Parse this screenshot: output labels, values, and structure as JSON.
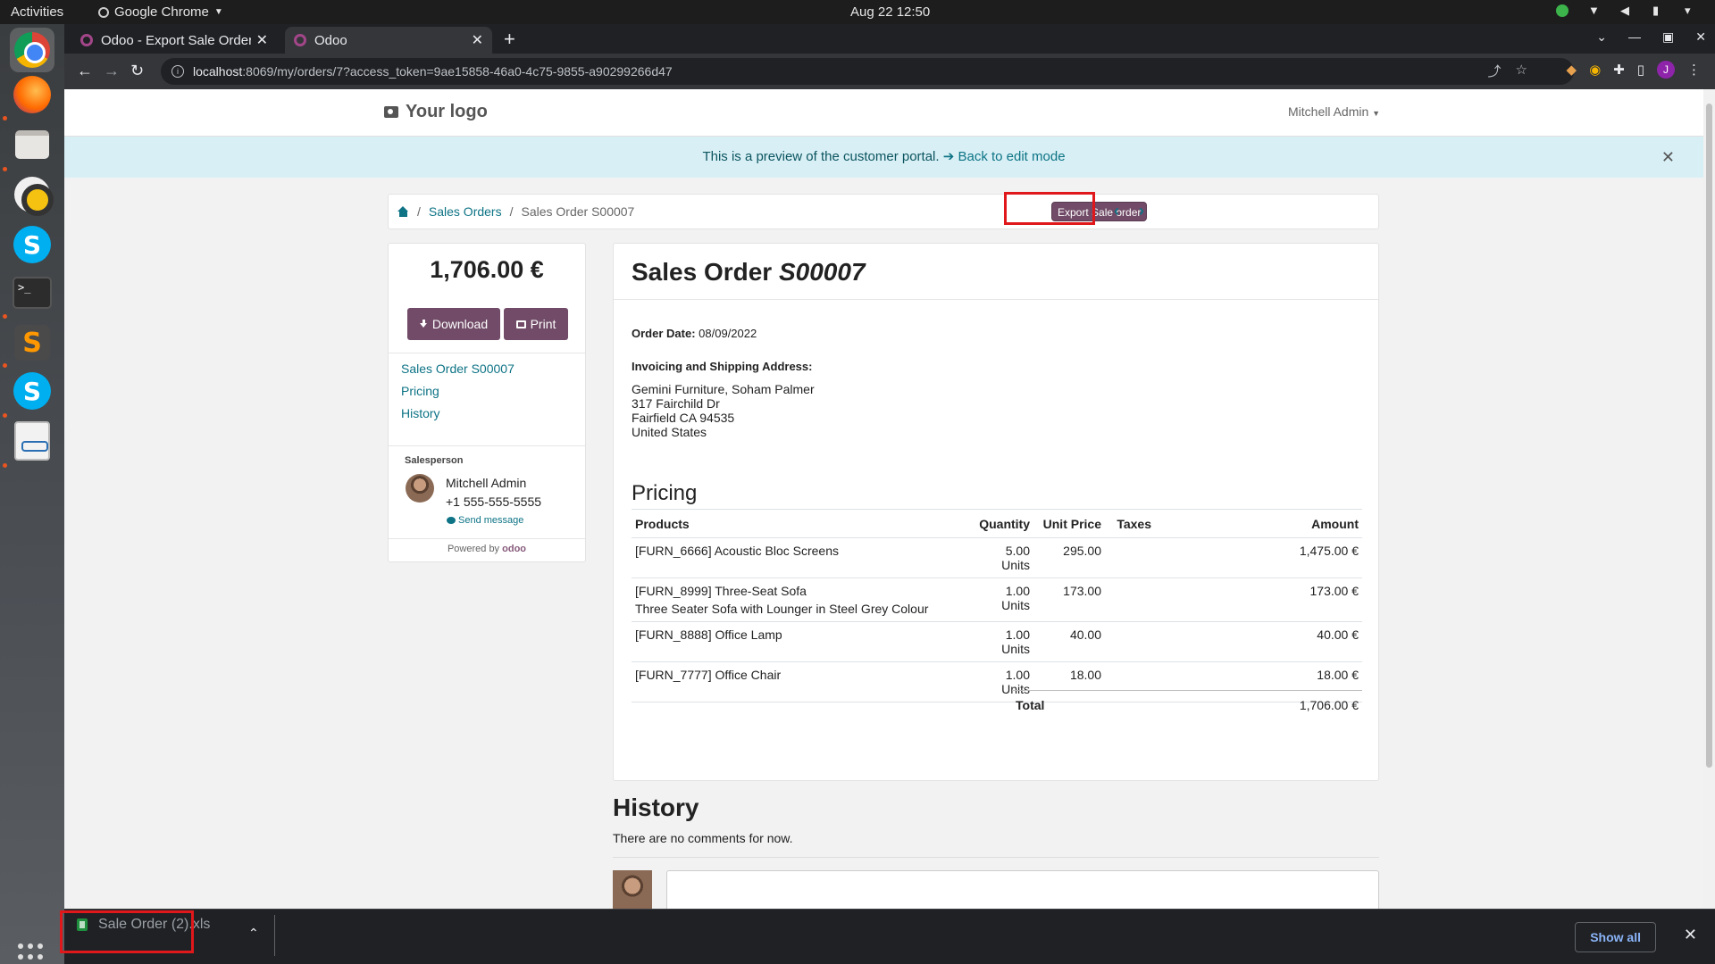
{
  "os": {
    "activities": "Activities",
    "app_name": "Google Chrome",
    "clock": "Aug 22  12:50"
  },
  "browser": {
    "tabs": [
      {
        "title": "Odoo - Export Sale Order",
        "active": false
      },
      {
        "title": "Odoo",
        "active": true
      }
    ],
    "url_host": "localhost",
    "url_rest": ":8069/my/orders/7?access_token=9ae15858-46a0-4c75-9855-a90299266d47",
    "profile_initial": "J"
  },
  "site": {
    "logo": "Your logo",
    "user": "Mitchell Admin"
  },
  "preview_banner": {
    "text": "This is a preview of the customer portal.",
    "link": "Back to edit mode"
  },
  "breadcrumb": {
    "items": [
      "Sales Orders",
      "Sales Order S00007"
    ],
    "export_label": "Export Sale order"
  },
  "sidebar": {
    "amount": "1,706.00 €",
    "download_label": "Download",
    "print_label": "Print",
    "links": [
      "Sales Order S00007",
      "Pricing",
      "History"
    ],
    "salesperson_label": "Salesperson",
    "salesperson_name": "Mitchell Admin",
    "salesperson_phone": "+1 555-555-5555",
    "send_message": "Send message",
    "powered_by": "Powered by",
    "powered_brand": "odoo"
  },
  "order": {
    "title_prefix": "Sales Order",
    "number": "S00007",
    "order_date_label": "Order Date:",
    "order_date": "08/09/2022",
    "address_label": "Invoicing and Shipping Address:",
    "address_lines": [
      "Gemini Furniture, Soham Palmer",
      "317 Fairchild Dr",
      "Fairfield CA 94535",
      "United States"
    ],
    "pricing_title": "Pricing",
    "columns": [
      "Products",
      "Quantity",
      "Unit Price",
      "Taxes",
      "Amount"
    ],
    "lines": [
      {
        "product": "[FURN_6666] Acoustic Bloc Screens",
        "desc": "",
        "qty": "5.00 Units",
        "price": "295.00",
        "taxes": "",
        "amount": "1,475.00 €"
      },
      {
        "product": "[FURN_8999] Three-Seat Sofa",
        "desc": "Three Seater Sofa with Lounger in Steel Grey Colour",
        "qty": "1.00 Units",
        "price": "173.00",
        "taxes": "",
        "amount": "173.00 €"
      },
      {
        "product": "[FURN_8888] Office Lamp",
        "desc": "",
        "qty": "1.00 Units",
        "price": "40.00",
        "taxes": "",
        "amount": "40.00 €"
      },
      {
        "product": "[FURN_7777] Office Chair",
        "desc": "",
        "qty": "1.00 Units",
        "price": "18.00",
        "taxes": "",
        "amount": "18.00 €"
      }
    ],
    "total_label": "Total",
    "total": "1,706.00 €"
  },
  "history": {
    "title": "History",
    "empty": "There are no comments for now."
  },
  "downloads": {
    "file": "Sale Order (2).xls",
    "show_all": "Show all"
  }
}
